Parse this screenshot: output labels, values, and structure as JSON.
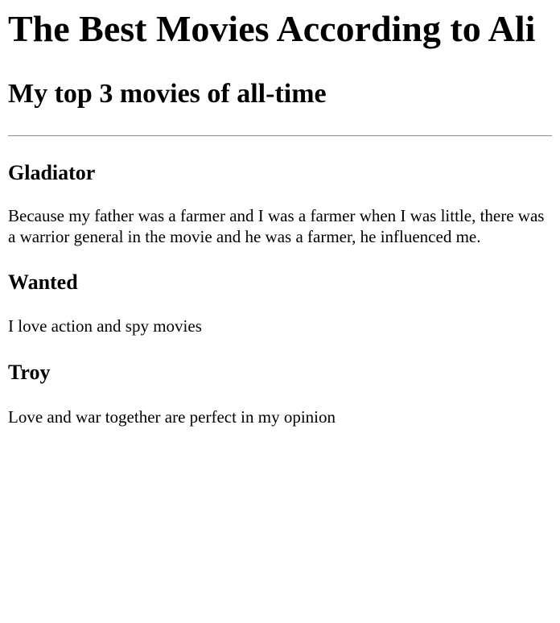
{
  "page": {
    "title": "The Best Movies According to Ali",
    "subtitle": "My top 3 movies of all-time"
  },
  "movies": [
    {
      "title": "Gladiator",
      "description": "Because my father was a farmer and I was a farmer when I was little, there was a warrior general in the movie and he was a farmer, he influenced me."
    },
    {
      "title": "Wanted",
      "description": "I love action and spy movies"
    },
    {
      "title": "Troy",
      "description": "Love and war together are perfect in my opinion"
    }
  ]
}
